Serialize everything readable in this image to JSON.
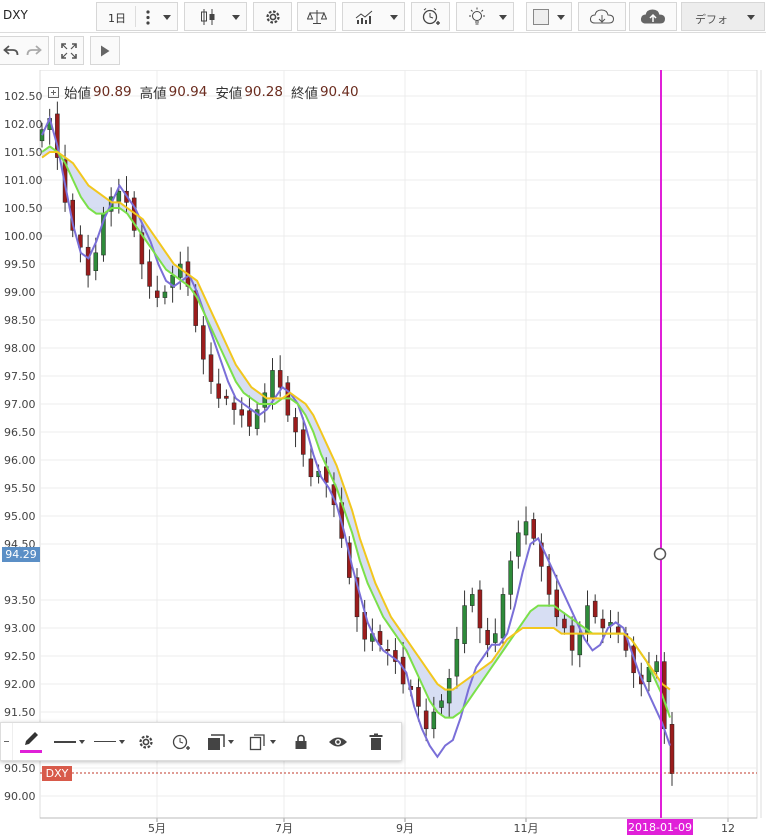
{
  "toolbar": {
    "symbol": "DXY",
    "interval": "1日",
    "template_label": "デフォ",
    "icons": [
      "more-vert-icon",
      "candlestick-icon",
      "settings-gear-icon",
      "compare-scale-icon",
      "indicators-icon",
      "alert-clock-icon",
      "idea-bulb-icon",
      "color-square-icon",
      "cloud-download-icon",
      "cloud-upload-icon"
    ]
  },
  "toolbar2": {
    "icons": [
      "undo-icon",
      "redo-icon",
      "fullscreen-icon",
      "play-icon"
    ]
  },
  "legend": {
    "open_label": "始値",
    "open": "90.89",
    "high_label": "高値",
    "high": "90.94",
    "low_label": "安値",
    "low": "90.28",
    "close_label": "終値",
    "close": "90.40"
  },
  "price_axis": {
    "labels": [
      "102.50",
      "102.00",
      "101.50",
      "101.00",
      "100.50",
      "100.00",
      "99.50",
      "99.00",
      "98.50",
      "98.00",
      "97.50",
      "97.00",
      "96.50",
      "96.00",
      "95.50",
      "95.00",
      "94.50",
      "93.50",
      "93.00",
      "92.50",
      "92.00",
      "91.50",
      "90.50",
      "90.00"
    ],
    "crosshair_value": "94.29",
    "crosshair_color": "#5b8fc6",
    "last_label": "DXY",
    "last_color": "#d85a4a"
  },
  "time_axis": {
    "labels": [
      "5月",
      "7月",
      "9月",
      "11月",
      "12"
    ],
    "crosshair_date": "2018-01-09",
    "crosshair_color": "#e020d8"
  },
  "drawing_toolbar": {
    "icons": [
      "pencil-icon",
      "line-style-icon",
      "line-width-icon",
      "settings-gear-icon",
      "alert-clock-icon",
      "layers-icon",
      "copy-icon",
      "lock-icon",
      "eye-icon",
      "trash-icon"
    ],
    "accent": "#e020d8"
  },
  "chart_data": {
    "type": "candlestick",
    "symbol": "DXY",
    "ylim": [
      89.8,
      102.7
    ],
    "x_ticks": [
      "5月",
      "7月",
      "9月",
      "11月",
      "12"
    ],
    "series": [
      {
        "color": "#7a6fd8",
        "values": [
          101.8,
          102.1,
          101.6,
          100.9,
          100.2,
          99.7,
          99.6,
          99.9,
          100.3,
          100.6,
          100.9,
          100.7,
          100.5,
          100.2,
          99.9,
          99.5,
          99.2,
          99.1,
          99.2,
          99.3,
          99.0,
          98.6,
          98.2,
          97.8,
          97.4,
          97.1,
          97.0,
          96.9,
          96.8,
          96.9,
          97.1,
          97.3,
          97.2,
          97.0,
          96.6,
          96.1,
          95.7,
          95.5,
          95.2,
          94.7,
          94.1,
          93.6,
          93.1,
          92.8,
          92.6,
          92.5,
          92.4,
          92.2,
          91.6,
          91.2,
          90.9,
          90.7,
          90.9,
          91.0,
          91.4,
          91.9,
          92.3,
          92.5,
          92.7,
          92.7,
          92.9,
          93.4,
          94.0,
          94.5,
          94.6,
          94.3,
          94.0,
          93.7,
          93.4,
          93.1,
          92.8,
          92.6,
          92.7,
          93.0,
          93.1,
          93.0,
          92.6,
          92.2,
          91.9,
          91.6,
          91.3,
          90.9
        ]
      },
      {
        "color": "#7be04a",
        "values": [
          101.5,
          101.6,
          101.5,
          101.3,
          101.0,
          100.7,
          100.5,
          100.4,
          100.4,
          100.5,
          100.5,
          100.4,
          100.2,
          100.0,
          99.8,
          99.6,
          99.4,
          99.3,
          99.2,
          99.1,
          98.9,
          98.6,
          98.3,
          98.0,
          97.7,
          97.4,
          97.2,
          97.1,
          97.0,
          97.0,
          97.0,
          97.1,
          97.1,
          97.0,
          96.8,
          96.5,
          96.1,
          95.8,
          95.5,
          95.1,
          94.7,
          94.2,
          93.8,
          93.5,
          93.2,
          93.0,
          92.8,
          92.6,
          92.3,
          92.0,
          91.7,
          91.5,
          91.4,
          91.4,
          91.5,
          91.7,
          91.9,
          92.1,
          92.3,
          92.5,
          92.7,
          92.9,
          93.1,
          93.3,
          93.4,
          93.4,
          93.4,
          93.3,
          93.2,
          93.1,
          93.0,
          92.9,
          92.9,
          92.9,
          92.9,
          92.9,
          92.8,
          92.6,
          92.4,
          92.1,
          91.8,
          91.4
        ]
      },
      {
        "color": "#f2c71e",
        "values": [
          101.4,
          101.5,
          101.5,
          101.4,
          101.3,
          101.1,
          100.9,
          100.8,
          100.7,
          100.6,
          100.6,
          100.5,
          100.4,
          100.3,
          100.1,
          99.9,
          99.7,
          99.5,
          99.4,
          99.3,
          99.2,
          98.9,
          98.6,
          98.3,
          98.0,
          97.7,
          97.5,
          97.3,
          97.2,
          97.1,
          97.1,
          97.1,
          97.2,
          97.1,
          97.0,
          96.8,
          96.5,
          96.2,
          95.9,
          95.5,
          95.1,
          94.6,
          94.2,
          93.8,
          93.5,
          93.2,
          93.0,
          92.8,
          92.6,
          92.4,
          92.2,
          92.0,
          91.9,
          91.9,
          92.0,
          92.1,
          92.2,
          92.3,
          92.4,
          92.6,
          92.8,
          92.9,
          93.0,
          93.0,
          93.0,
          93.0,
          93.0,
          92.9,
          92.9,
          92.9,
          92.9,
          92.9,
          92.9,
          92.9,
          92.9,
          92.9,
          92.8,
          92.6,
          92.4,
          92.2,
          92.0,
          91.9
        ]
      }
    ],
    "candles_close": [
      101.9,
      102.1,
      101.4,
      100.6,
      100.1,
      99.8,
      99.3,
      99.7,
      100.4,
      100.7,
      100.8,
      100.6,
      100.1,
      99.5,
      99.1,
      98.9,
      99.0,
      99.3,
      99.5,
      99.1,
      98.4,
      97.8,
      97.4,
      97.1,
      97.1,
      96.9,
      96.8,
      96.6,
      96.9,
      97.2,
      97.6,
      97.3,
      96.8,
      96.5,
      96.1,
      95.7,
      95.8,
      95.6,
      95.2,
      94.6,
      93.9,
      93.2,
      92.8,
      92.9,
      92.7,
      92.6,
      92.4,
      92.0,
      91.9,
      91.6,
      91.2,
      91.5,
      91.7,
      92.1,
      92.8,
      93.4,
      93.6,
      93.0,
      92.7,
      92.9,
      93.6,
      94.2,
      94.7,
      94.9,
      94.6,
      94.1,
      93.6,
      93.2,
      93.0,
      92.6,
      92.9,
      93.4,
      93.2,
      93.0,
      93.1,
      92.9,
      92.6,
      92.2,
      92.0,
      92.3,
      92.4,
      91.2,
      90.4
    ]
  }
}
